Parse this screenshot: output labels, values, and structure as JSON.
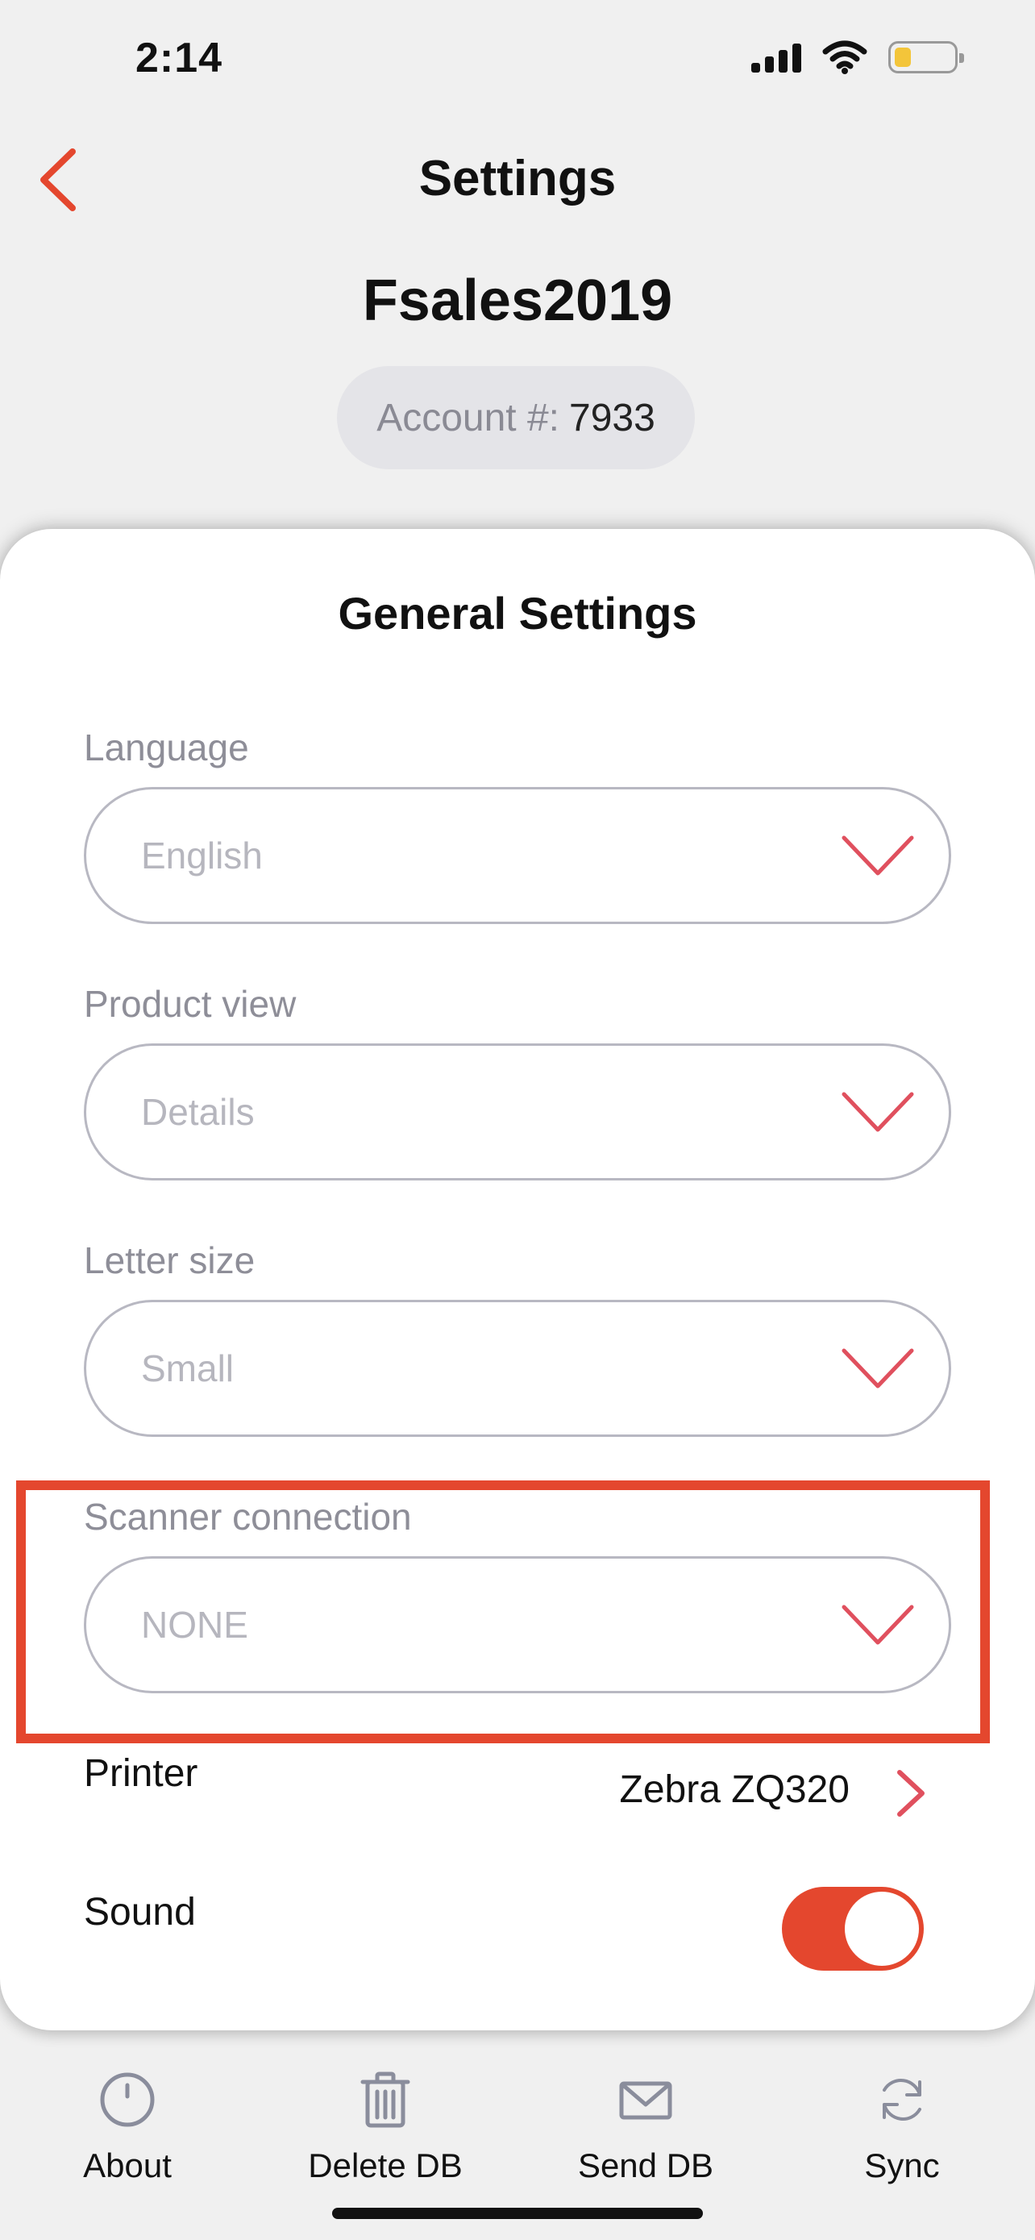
{
  "status_bar": {
    "time": "2:14"
  },
  "header": {
    "title": "Settings",
    "account_name": "Fsales2019",
    "account_label": "Account #:",
    "account_number": "7933"
  },
  "card": {
    "title": "General Settings",
    "fields": [
      {
        "label": "Language",
        "value": "English"
      },
      {
        "label": "Product view",
        "value": "Details"
      },
      {
        "label": "Letter size",
        "value": "Small"
      },
      {
        "label": "Scanner connection",
        "value": "NONE"
      }
    ],
    "printer": {
      "label": "Printer",
      "value": "Zebra ZQ320"
    },
    "sound": {
      "label": "Sound",
      "enabled": true
    }
  },
  "toolbar": {
    "items": [
      {
        "label": "About",
        "icon": "info-circle-icon"
      },
      {
        "label": "Delete DB",
        "icon": "trash-icon"
      },
      {
        "label": "Send DB",
        "icon": "envelope-icon"
      },
      {
        "label": "Sync",
        "icon": "sync-icon"
      }
    ]
  },
  "colors": {
    "accent": "#e4472e",
    "chevron": "#e0505e",
    "muted_text": "#8e8e98",
    "icon_gray": "#8a8d9c"
  }
}
